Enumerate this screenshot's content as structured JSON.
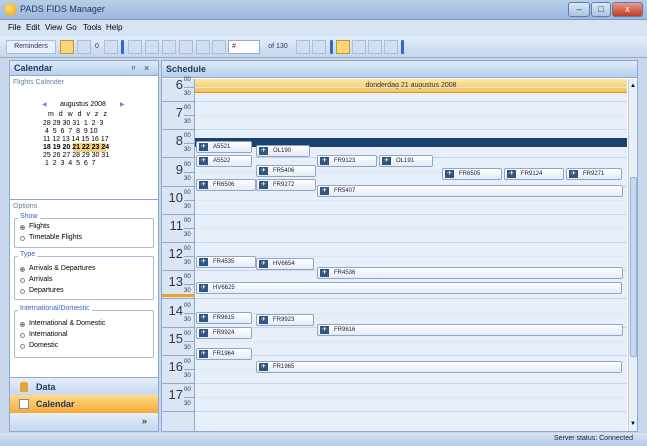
{
  "window": {
    "title": "PADS FIDS Manager",
    "minimize": "–",
    "maximize": "□",
    "close": "x"
  },
  "menu": [
    "File",
    "Edit",
    "View",
    "Go",
    "Tools",
    "Help"
  ],
  "toolbar": {
    "reminders": "Reminders",
    "count0": "0",
    "record_input": "#",
    "record_of": "of 130"
  },
  "left": {
    "title": "Calendar",
    "pin": "ᵖ",
    "close": "×",
    "calendar_sub": "Flights Calender",
    "month": "augustus 2008",
    "prev": "◀",
    "next": "▶",
    "weekdays": "m d w d v z z",
    "weeks": [
      "28 29 30 31  1  2  3",
      " 4  5  6  7  8  9 10",
      "11 12 13 14 15 16 17",
      "18 19 20 21 22 23 24",
      "25 26 27 28 29 30 31",
      " 1  2  3  4  5  6  7"
    ],
    "options_sub": "Options",
    "show_label": "Show",
    "show": [
      {
        "label": "Flights",
        "on": true
      },
      {
        "label": "Timetable Flights",
        "on": false
      }
    ],
    "type_label": "Type",
    "type": [
      {
        "label": "Arrivals & Departures",
        "on": true
      },
      {
        "label": "Arrivals",
        "on": false
      },
      {
        "label": "Departures",
        "on": false
      }
    ],
    "intl_label": "International/Domestic",
    "intl": [
      {
        "label": "International & Domestic",
        "on": true
      },
      {
        "label": "International",
        "on": false
      },
      {
        "label": "Domestic",
        "on": false
      }
    ],
    "nav_data": "Data",
    "nav_calendar": "Calendar",
    "nav_more": "»"
  },
  "schedule": {
    "title": "Schedule",
    "day": "donderdag 21 augustus 2008",
    "hours": [
      "6",
      "7",
      "8",
      "9",
      "10",
      "11",
      "12",
      "13",
      "14",
      "15",
      "16",
      "17"
    ],
    "min00": "00",
    "min30": "30",
    "flights": [
      "A5521",
      "OL190",
      "A5522",
      "FR9123",
      "OL191",
      "FR5406",
      "FR6505",
      "FR9124",
      "FR9271",
      "FR6506",
      "FR9272",
      "FR5407",
      "FR4535",
      "HV6654",
      "FR4536",
      "HV6625",
      "FR9615",
      "FR9923",
      "FR9924",
      "FR9616",
      "FR1964",
      "FR1965"
    ]
  },
  "status": "Server status: Connected"
}
